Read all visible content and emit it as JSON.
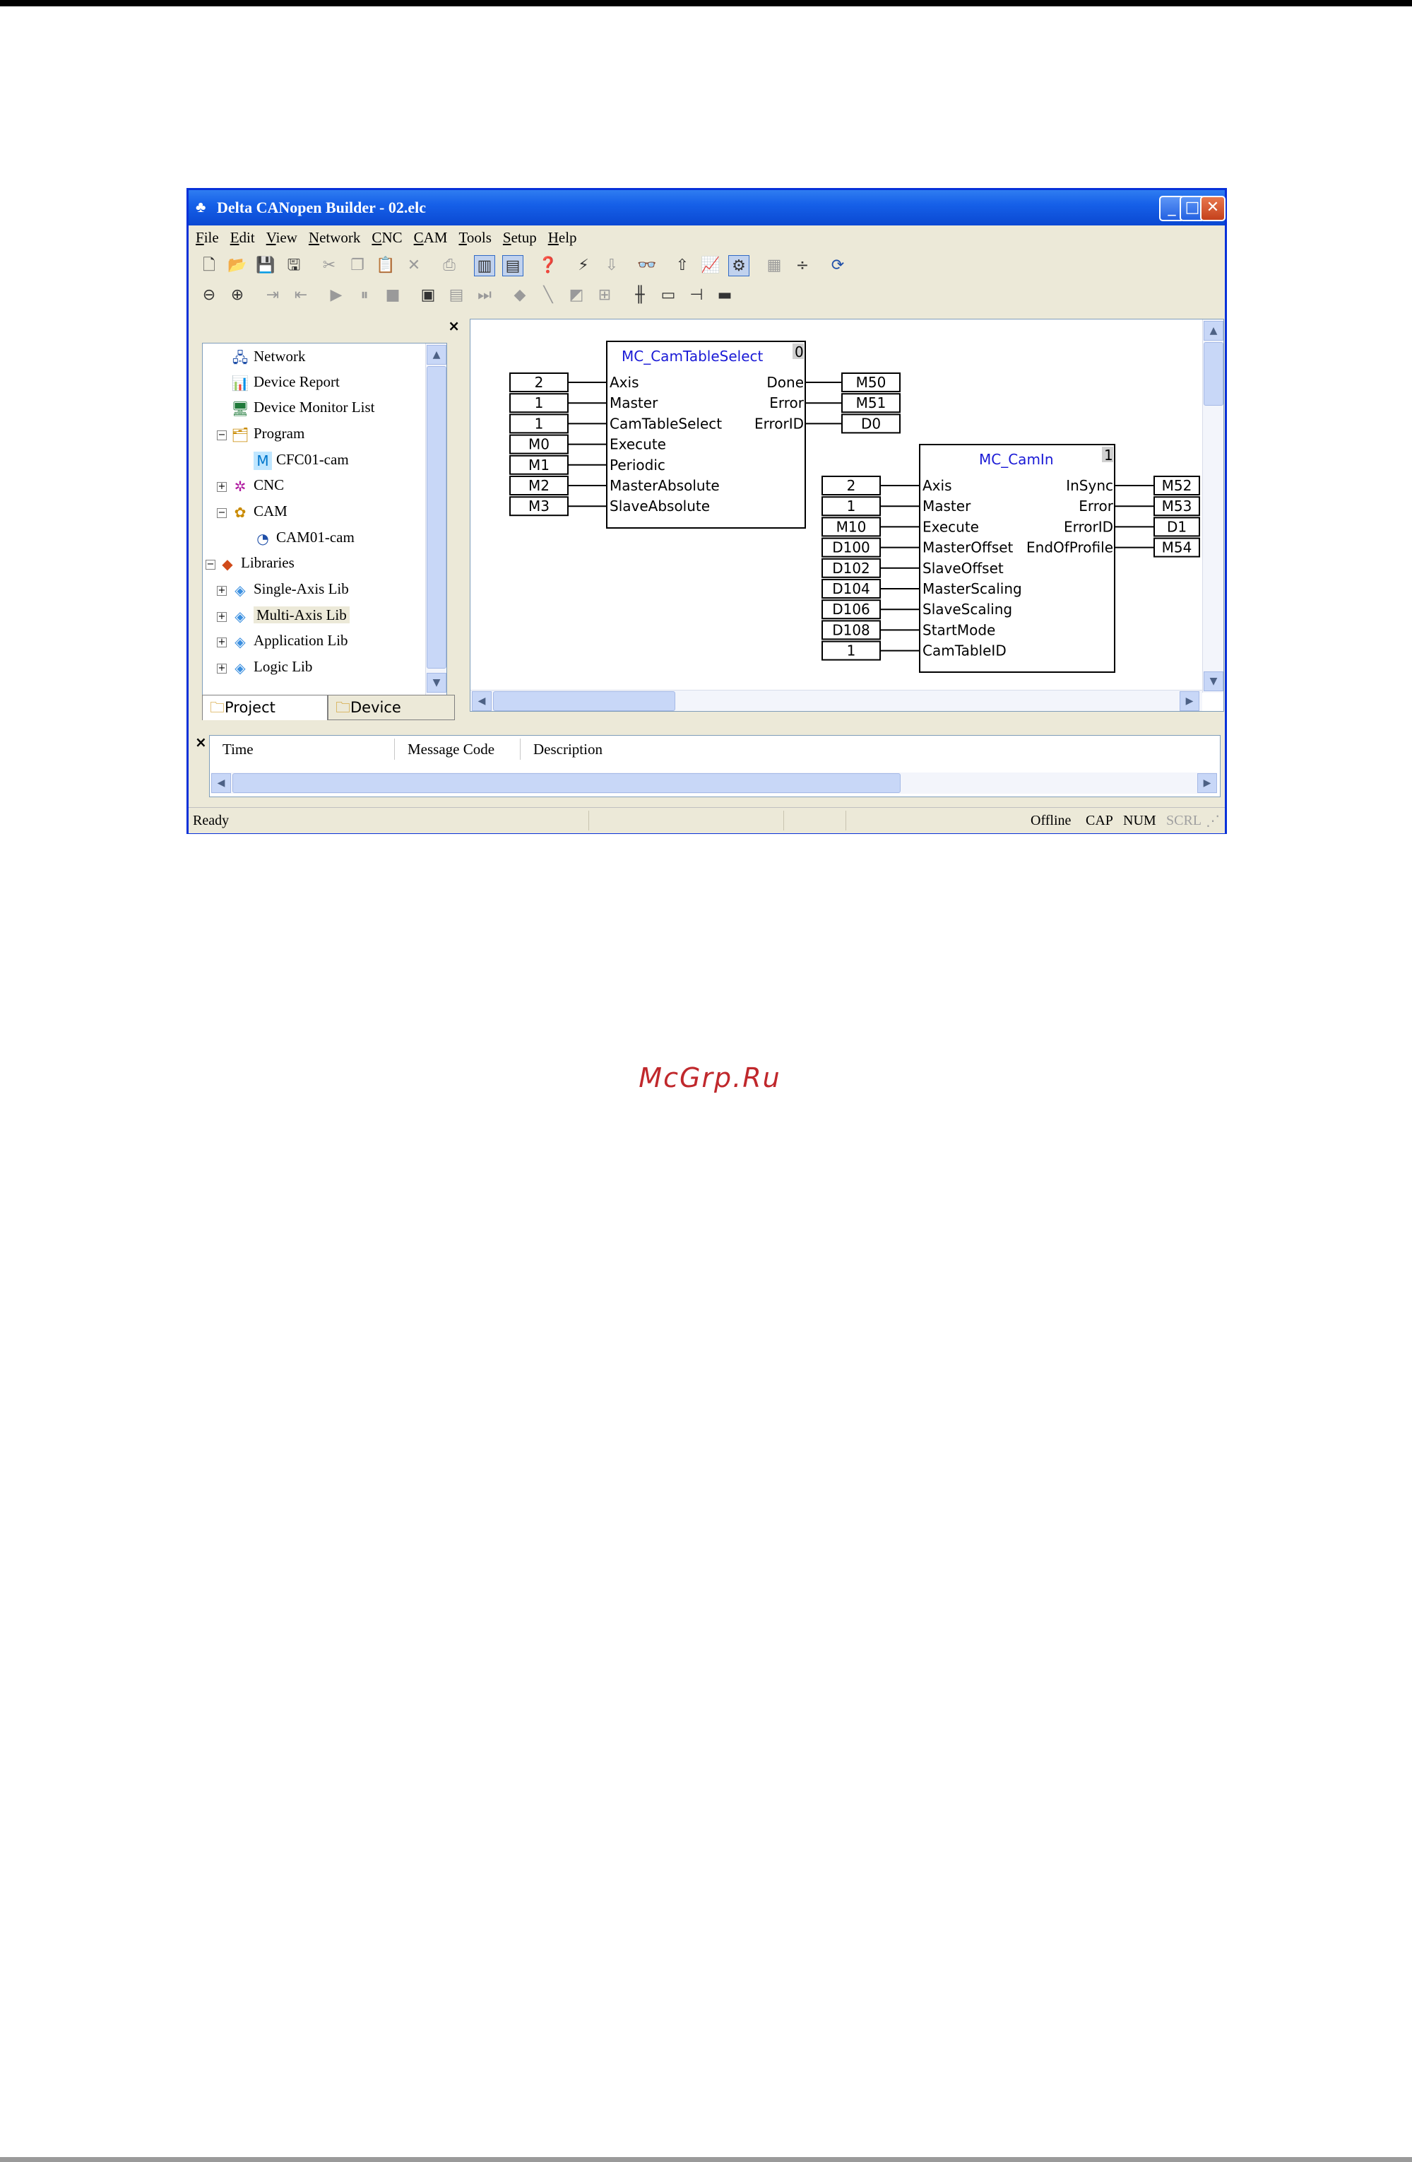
{
  "window": {
    "title": "Delta CANopen Builder - 02.elc",
    "controls": {
      "minimize": "_",
      "maximize": "□",
      "close": "✕"
    }
  },
  "menu": [
    {
      "key": "F",
      "rest": "ile"
    },
    {
      "key": "E",
      "rest": "dit"
    },
    {
      "key": "V",
      "rest": "iew"
    },
    {
      "key": "N",
      "rest": "etwork"
    },
    {
      "key": "C",
      "rest": "NC"
    },
    {
      "key": "C",
      "rest": "AM",
      "pre": ""
    },
    {
      "key": "T",
      "rest": "ools"
    },
    {
      "key": "S",
      "rest": "etup"
    },
    {
      "key": "H",
      "rest": "elp"
    }
  ],
  "tree": {
    "items": [
      {
        "label": "Network",
        "icon": "network-icon"
      },
      {
        "label": "Device Report",
        "icon": "report-icon"
      },
      {
        "label": "Device Monitor List",
        "icon": "monitor-icon"
      },
      {
        "label": "Program",
        "icon": "program-icon"
      },
      {
        "label": "CFC01-cam",
        "icon": "cfc-icon"
      },
      {
        "label": "CNC",
        "icon": "cnc-icon"
      },
      {
        "label": "CAM",
        "icon": "cam-icon"
      },
      {
        "label": "CAM01-cam",
        "icon": "cam-file-icon"
      },
      {
        "label": "Libraries",
        "icon": "libraries-icon"
      },
      {
        "label": "Single-Axis Lib",
        "icon": "cube-icon"
      },
      {
        "label": "Multi-Axis Lib",
        "icon": "cube-icon"
      },
      {
        "label": "Application Lib",
        "icon": "cube-icon"
      },
      {
        "label": "Logic Lib",
        "icon": "cube-icon"
      }
    ]
  },
  "tabs": {
    "project": "Project",
    "device": "Device"
  },
  "blocks": {
    "camtableselect": {
      "name": "MC_CamTableSelect",
      "index": "0",
      "inputs": [
        "Axis",
        "Master",
        "CamTableSelect",
        "Execute",
        "Periodic",
        "MasterAbsolute",
        "SlaveAbsolute"
      ],
      "input_values": [
        "2",
        "1",
        "1",
        "M0",
        "M1",
        "M2",
        "M3"
      ],
      "outputs": [
        "Done",
        "Error",
        "ErrorID"
      ],
      "output_values": [
        "M50",
        "M51",
        "D0"
      ]
    },
    "camin": {
      "name": "MC_CamIn",
      "index": "1",
      "inputs": [
        "Axis",
        "Master",
        "Execute",
        "MasterOffset",
        "SlaveOffset",
        "MasterScaling",
        "SlaveScaling",
        "StartMode",
        "CamTableID"
      ],
      "input_values": [
        "2",
        "1",
        "M10",
        "D100",
        "D102",
        "D104",
        "D106",
        "D108",
        "1"
      ],
      "outputs": [
        "InSync",
        "Error",
        "ErrorID",
        "EndOfProfile"
      ],
      "output_values": [
        "M52",
        "M53",
        "D1",
        "M54"
      ]
    }
  },
  "messages": {
    "col_time": "Time",
    "col_code": "Message Code",
    "col_desc": "Description"
  },
  "status": {
    "ready": "Ready",
    "offline": "Offline",
    "cap": "CAP",
    "num": "NUM",
    "scrl": "SCRL"
  },
  "watermark": "McGrp.Ru"
}
